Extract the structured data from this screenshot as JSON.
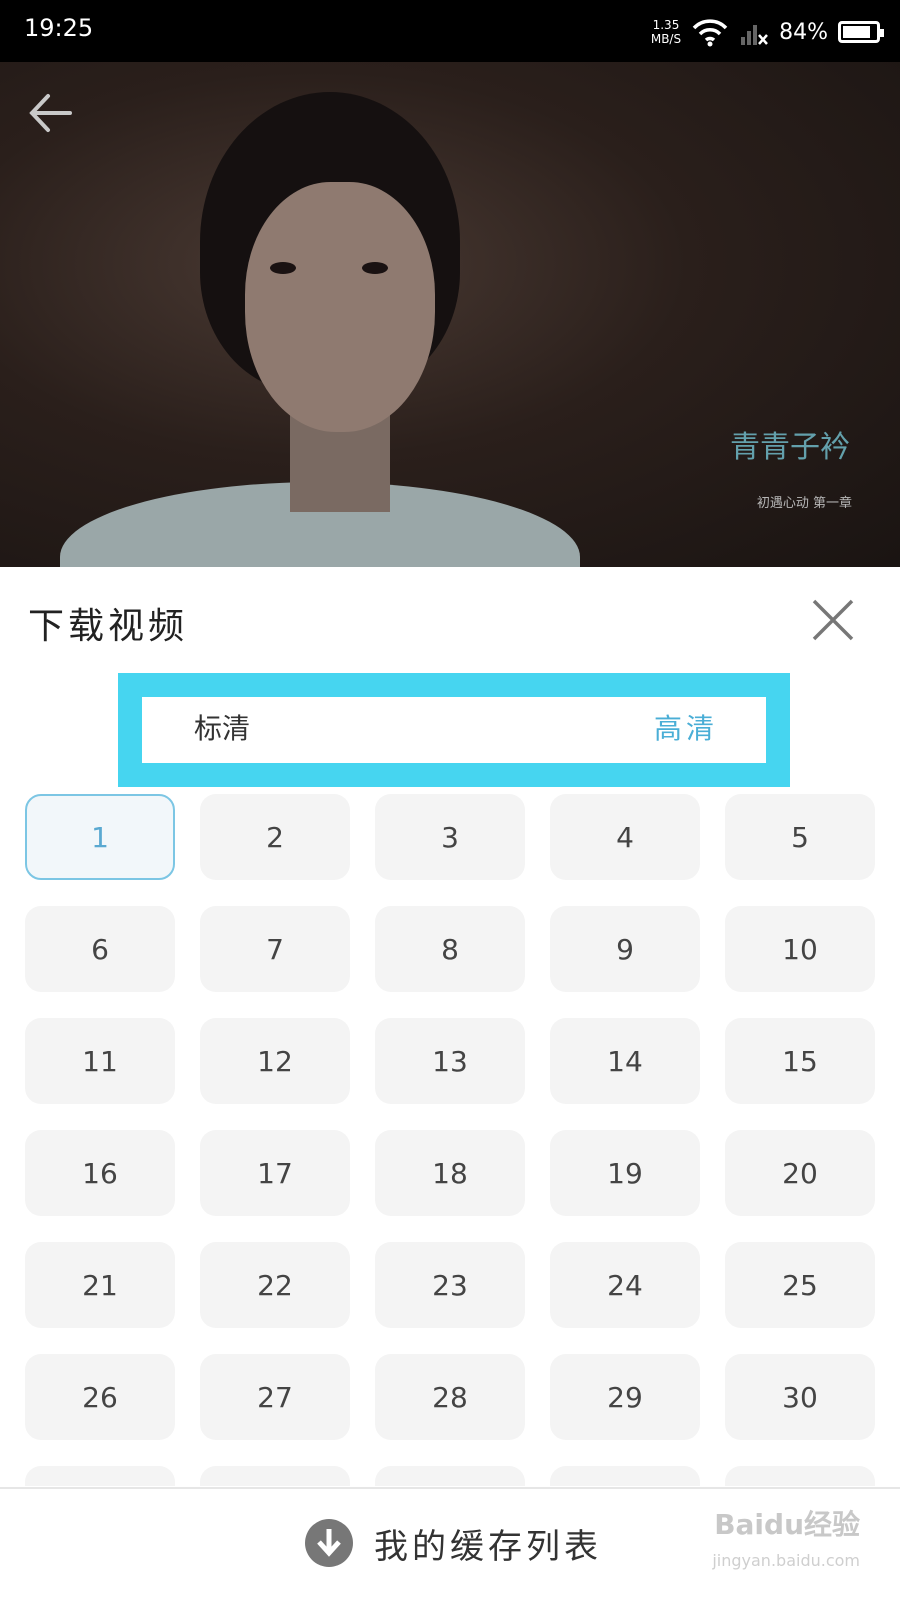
{
  "status_bar": {
    "time": "19:25",
    "net_speed_value": "1.35",
    "net_speed_unit": "MB/S",
    "battery_percent": "84%",
    "battery_level": 0.84
  },
  "video": {
    "watermark_logo": "青青子衿",
    "watermark_subtitle": "初遇心动 第一章"
  },
  "panel": {
    "title": "下载视频",
    "quality": {
      "standard_label": "标清",
      "high_label": "高清",
      "selected": "高清",
      "highlight_color": "#46d5f0",
      "active_color": "#4aaed6"
    },
    "episodes": [
      "1",
      "2",
      "3",
      "4",
      "5",
      "6",
      "7",
      "8",
      "9",
      "10",
      "11",
      "12",
      "13",
      "14",
      "15",
      "16",
      "17",
      "18",
      "19",
      "20",
      "21",
      "22",
      "23",
      "24",
      "25",
      "26",
      "27",
      "28",
      "29",
      "30"
    ],
    "selected_episode": "1"
  },
  "bottom_bar": {
    "cache_label": "我的缓存列表",
    "brand_watermark": "Baidu经验",
    "brand_url": "jingyan.baidu.com"
  }
}
